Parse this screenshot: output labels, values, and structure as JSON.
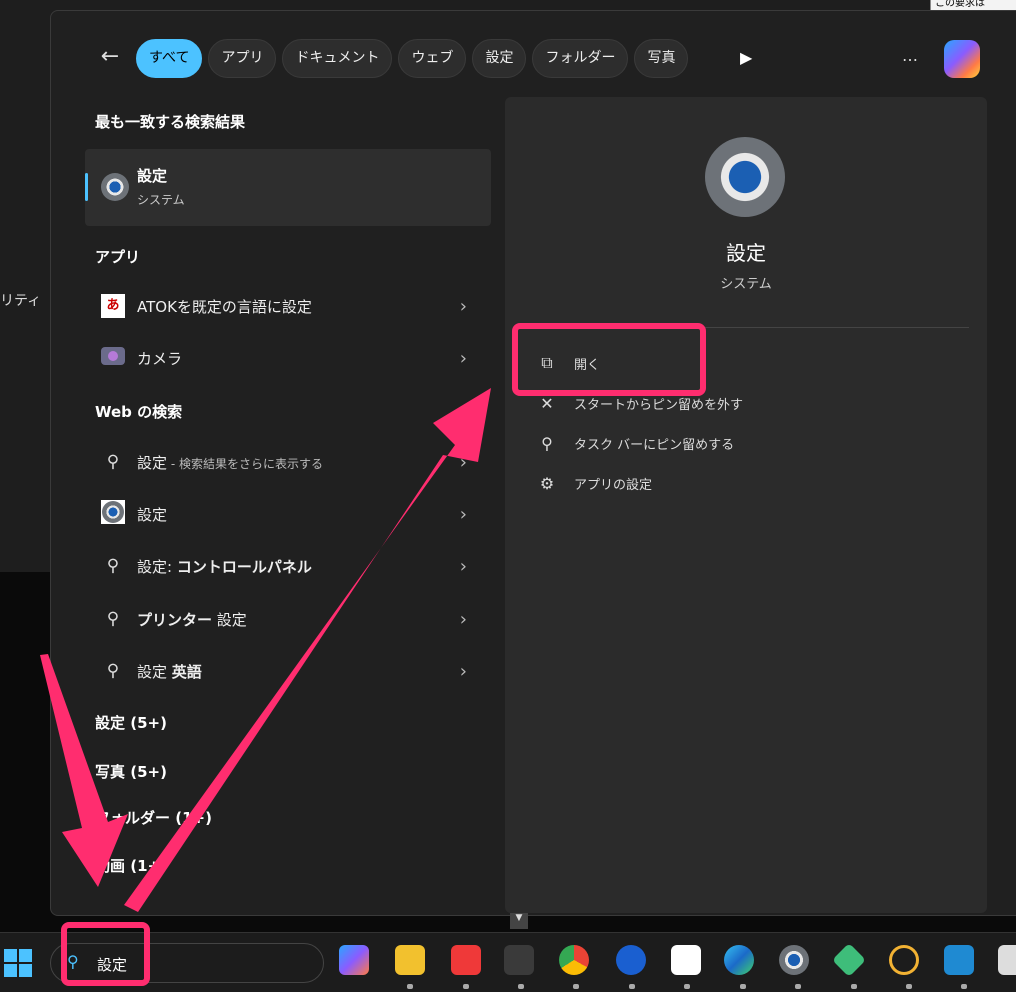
{
  "background": {
    "edge_text": "リティ",
    "corner_note": "この要求は"
  },
  "filters": {
    "back": "←",
    "chips": [
      "すべて",
      "アプリ",
      "ドキュメント",
      "ウェブ",
      "設定",
      "フォルダー",
      "写真"
    ],
    "more": "…",
    "play": "▶"
  },
  "left": {
    "best_heading": "最も一致する検索結果",
    "best": {
      "title": "設定",
      "subtitle": "システム"
    },
    "apps_heading": "アプリ",
    "apps": [
      {
        "label": "ATOKを既定の言語に設定",
        "icon": "atok-icon"
      },
      {
        "label": "カメラ",
        "icon": "camera-icon"
      }
    ],
    "web_heading": "Web の検索",
    "web": [
      {
        "main": "設定",
        "sub": " - 検索結果をさらに表示する"
      },
      {
        "main": "設定"
      },
      {
        "main": "設定: ",
        "bold": "コントロールパネル"
      },
      {
        "bold": "プリンター",
        "main": " 設定"
      },
      {
        "main": "設定 ",
        "bold": "英語"
      }
    ],
    "groups": [
      "設定 (5+)",
      "写真 (5+)",
      "フォルダー (1+)",
      "動画 (1+)"
    ]
  },
  "right": {
    "title": "設定",
    "subtitle": "システム",
    "actions": [
      {
        "label": "開く",
        "icon": "open-external-icon"
      },
      {
        "label": "スタートからピン留めを外す",
        "icon": "unpin-icon"
      },
      {
        "label": "タスク バーにピン留めする",
        "icon": "pin-icon"
      },
      {
        "label": "アプリの設定",
        "icon": "gear-icon"
      }
    ]
  },
  "taskbar": {
    "search_value": "設定",
    "apps": [
      "copilot",
      "file-explorer",
      "vivaldi",
      "terminal",
      "chrome",
      "1password",
      "deepl",
      "edge",
      "settings",
      "app-green",
      "app-yellow",
      "vscode",
      "app-other"
    ]
  },
  "colors": {
    "accent": "#4cc2ff",
    "highlight": "#ff2d6f"
  }
}
